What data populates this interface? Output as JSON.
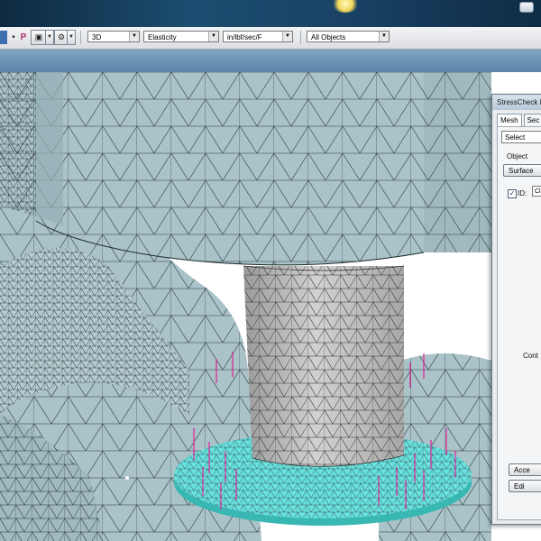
{
  "toolbar": {
    "mode_dropdown": "3D",
    "material_dropdown": "Elasticity",
    "units_dropdown": "in/lbf/sec/F",
    "objects_dropdown": "All Objects",
    "p_label": "P"
  },
  "dialog": {
    "title": "StressCheck In",
    "tabs": [
      {
        "label": "Mesh"
      },
      {
        "label": "Sec"
      }
    ],
    "select_value": "Select",
    "object_label": "Object",
    "object_button": "Surface",
    "id_label": "ID:",
    "id_value": "Cl",
    "contour_label": "Cont",
    "accept_button": "Acce",
    "edit_button": "Edi"
  },
  "colors": {
    "mesh_fill": "#a9c3c8",
    "pin_fill": "#c6c5c4",
    "washer_fill": "#69e3e0",
    "load_vectors": "#e0209a"
  }
}
